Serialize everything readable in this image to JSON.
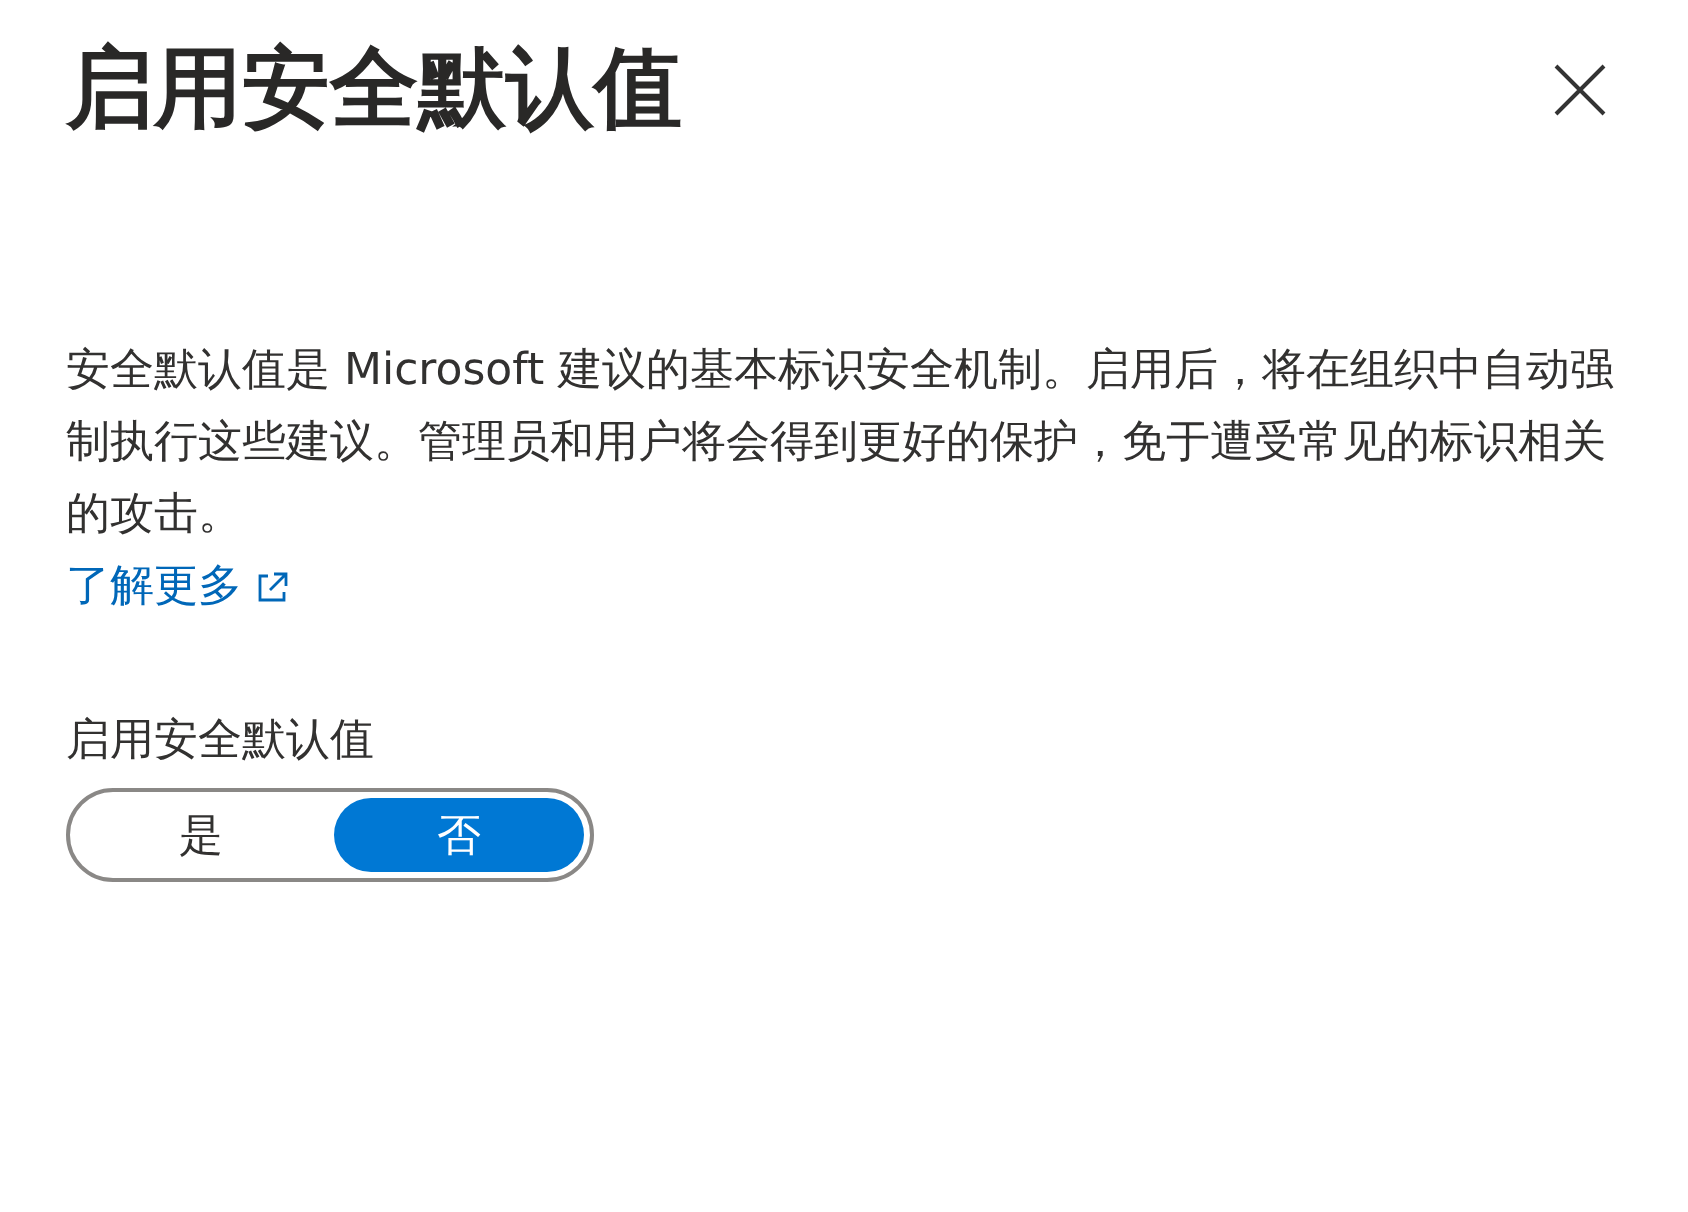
{
  "title": "启用安全默认值",
  "description": "安全默认值是 Microsoft 建议的基本标识安全机制。启用后，将在组织中自动强制执行这些建议。管理员和用户将会得到更好的保护，免于遭受常见的标识相关的攻击。",
  "learn_more": {
    "label": "了解更多"
  },
  "toggle": {
    "label": "启用安全默认值",
    "options": [
      {
        "label": "是",
        "selected": false
      },
      {
        "label": "否",
        "selected": true
      }
    ]
  }
}
